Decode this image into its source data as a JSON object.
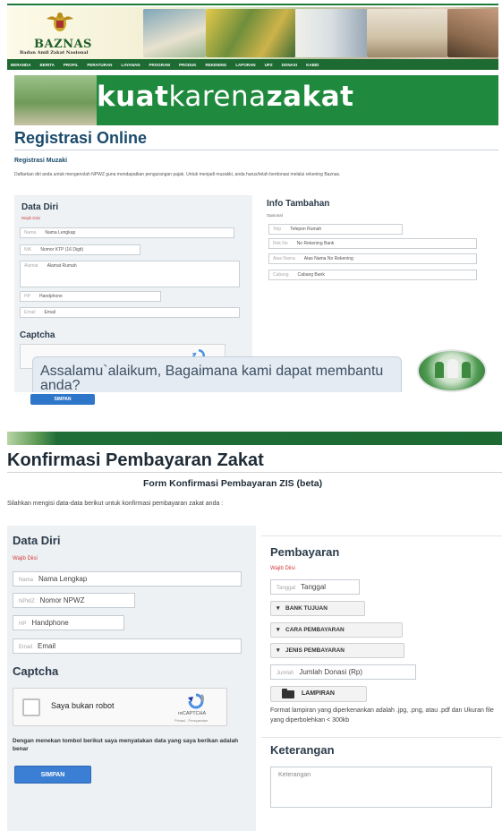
{
  "colors": {
    "brand_green": "#1d6b33",
    "primary_blue": "#3b7fd4",
    "heading_navy": "#1b4b6b",
    "required_red": "#d03a3a"
  },
  "registration_page": {
    "logo_text": "BAZNAS",
    "logo_subtitle": "Badan Amil Zakat Nasional",
    "nav": [
      "BERANDA",
      "BERITA",
      "PROFIL",
      "PERATURAN",
      "LAYANAN",
      "PROGRAM",
      "PRODUK",
      "REKENING",
      "LAPORAN",
      "UPZ",
      "DONASI",
      "KABID"
    ],
    "banner": {
      "part_bold1": "kuat",
      "part_light": "karena",
      "part_bold2": "zakat"
    },
    "title": "Registrasi Online",
    "subtitle": "Registrasi Muzaki",
    "description": "Daftarkan diri anda untuk mengenolah NPWZ guna mendapatkan pengurangan pajak. Untuk menjadi muzakki, anda harus/telah berdonasi melalui rekening Baznas.",
    "data_diri": {
      "title": "Data Diri",
      "required": "Wajib Diisi",
      "fields": [
        {
          "label": "Nama",
          "placeholder": "Nama Lengkap"
        },
        {
          "label": "NIK",
          "placeholder": "Nomor KTP (16 Digit)"
        },
        {
          "label": "Alamat",
          "placeholder": "Alamat Rumah"
        },
        {
          "label": "HP",
          "placeholder": "Handphone"
        },
        {
          "label": "Email",
          "placeholder": "Email"
        }
      ]
    },
    "captcha_title": "Captcha",
    "submit": "SIMPAN",
    "info_tambahan": {
      "title": "Info Tambahan",
      "optional": "Opsional",
      "fields": [
        {
          "label": "Telp",
          "placeholder": "Telepon Rumah"
        },
        {
          "label": "Rek No",
          "placeholder": "No Rekening Bank"
        },
        {
          "label": "Atas Nama",
          "placeholder": "Atas Nama No Rekening"
        },
        {
          "label": "Cabang",
          "placeholder": "Cabang Bank"
        }
      ]
    },
    "chat_message": "Assalamu`alaikum, Bagaimana kami dapat membantu anda?"
  },
  "confirmation_page": {
    "title": "Konfirmasi Pembayaran Zakat",
    "form_title": "Form Konfirmasi Pembayaran ZIS (beta)",
    "description": "Silahkan mengisi data-data berikut untuk konfirmasi pembayaran zakat anda :",
    "data_diri": {
      "title": "Data Diri",
      "required": "Wajib Diisi",
      "fields": [
        {
          "label": "Nama",
          "placeholder": "Nama Lengkap"
        },
        {
          "label": "NPWZ",
          "placeholder": "Nomor NPWZ"
        },
        {
          "label": "HP",
          "placeholder": "Handphone"
        },
        {
          "label": "Email",
          "placeholder": "Email"
        }
      ]
    },
    "captcha": {
      "title": "Captcha",
      "checkbox_label": "Saya bukan robot",
      "brand": "reCAPTCHA",
      "terms": "Privasi - Persyaratan"
    },
    "agreement": "Dengan menekan tombol berikut saya menyatakan data yang saya berikan adalah benar",
    "submit": "SIMPAN",
    "pembayaran": {
      "title": "Pembayaran",
      "required": "Wajib Diisi",
      "tanggal": {
        "label": "Tanggal",
        "placeholder": "Tanggal"
      },
      "dropdowns": [
        "BANK TUJUAN",
        "CARA PEMBAYARAN",
        "JENIS PEMBAYARAN"
      ],
      "jumlah": {
        "label": "Jumlah",
        "placeholder": "Jumlah Donasi (Rp)"
      },
      "attachment": "LAMPIRAN",
      "format_note": "Format lampiran yang diperkenankan adalah .jpg, .png, atau .pdf dan Ukuran file yang diperbolehkan < 300kb"
    },
    "keterangan": {
      "title": "Keterangan",
      "placeholder": "Keterangan"
    }
  }
}
